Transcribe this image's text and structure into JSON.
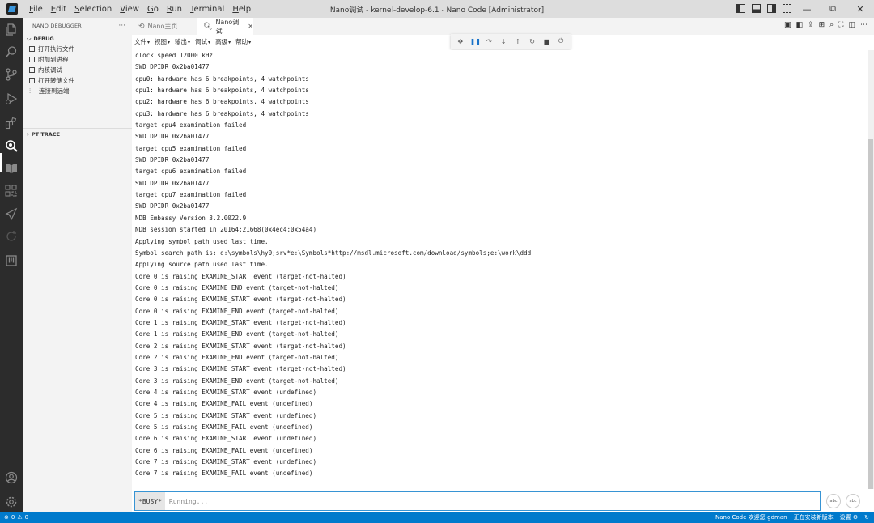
{
  "window": {
    "title": "Nano调试 - kernel-develop-6.1 - Nano Code [Administrator]",
    "menu": [
      "File",
      "Edit",
      "Selection",
      "View",
      "Go",
      "Run",
      "Terminal",
      "Help"
    ],
    "controls": {
      "minimize": "—",
      "restore": "⧉",
      "close": "✕"
    }
  },
  "activity_bar": {
    "icons": [
      "files-icon",
      "search-icon",
      "source-control-icon",
      "run-debug-icon",
      "extensions-icon",
      "nano-debug-icon",
      "book-icon",
      "apps-icon",
      "rocket-icon",
      "sync-icon",
      "board-icon"
    ],
    "bottom": [
      "account-icon",
      "settings-gear-icon"
    ],
    "active": "nano-debug-icon"
  },
  "sidebar": {
    "header": "NANO DEBUGGER",
    "more": "···",
    "debug_section": "DEBUG",
    "items": [
      "打开执行文件",
      "附加到进程",
      "内核调试",
      "打开转储文件",
      "连接到远端"
    ],
    "pt_trace_section": "PT TRACE"
  },
  "tabs": [
    {
      "label": "Nano主页",
      "icon": "nano-home-icon"
    },
    {
      "label": "Nano调试",
      "icon": "search-debug-icon",
      "close": "✕"
    }
  ],
  "editor_toolbar": [
    "文件",
    "视图",
    "输出",
    "调试",
    "高级",
    "帮助"
  ],
  "debug_toolbar": [
    "move-handle-icon",
    "pause-icon",
    "step-over-icon",
    "step-into-icon",
    "step-out-icon",
    "restart-icon",
    "stop-icon",
    "disconnect-icon"
  ],
  "console_lines": [
    "clock speed 12000 kHz",
    "SWD DPIDR 0x2ba01477",
    "cpu0: hardware has 6 breakpoints, 4 watchpoints",
    "cpu1: hardware has 6 breakpoints, 4 watchpoints",
    "cpu2: hardware has 6 breakpoints, 4 watchpoints",
    "cpu3: hardware has 6 breakpoints, 4 watchpoints",
    "target cpu4 examination failed",
    "SWD DPIDR 0x2ba01477",
    "target cpu5 examination failed",
    "SWD DPIDR 0x2ba01477",
    "target cpu6 examination failed",
    "SWD DPIDR 0x2ba01477",
    "target cpu7 examination failed",
    "SWD DPIDR 0x2ba01477",
    "NDB Embassy Version 3.2.0022.9",
    "NDB session started in 20164:21668(0x4ec4:0x54a4)",
    "Applying symbol path used last time.",
    "Symbol search path is: d:\\symbols\\hy0;srv*e:\\Symbols*http://msdl.microsoft.com/download/symbols;e:\\work\\ddd",
    "Applying source path used last time.",
    "Core 0 is raising EXAMINE_START event (target-not-halted)",
    "Core 0 is raising EXAMINE_END event (target-not-halted)",
    "Core 0 is raising EXAMINE_START event (target-not-halted)",
    "Core 0 is raising EXAMINE_END event (target-not-halted)",
    "Core 1 is raising EXAMINE_START event (target-not-halted)",
    "Core 1 is raising EXAMINE_END event (target-not-halted)",
    "Core 2 is raising EXAMINE_START event (target-not-halted)",
    "Core 2 is raising EXAMINE_END event (target-not-halted)",
    "Core 3 is raising EXAMINE_START event (target-not-halted)",
    "Core 3 is raising EXAMINE_END event (target-not-halted)",
    "Core 4 is raising EXAMINE_START event (undefined)",
    "Core 4 is raising EXAMINE_FAIL event (undefined)",
    "Core 5 is raising EXAMINE_START event (undefined)",
    "Core 5 is raising EXAMINE_FAIL event (undefined)",
    "Core 6 is raising EXAMINE_START event (undefined)",
    "Core 6 is raising EXAMINE_FAIL event (undefined)",
    "Core 7 is raising EXAMINE_START event (undefined)",
    "Core 7 is raising EXAMINE_FAIL event (undefined)"
  ],
  "command": {
    "busy_label": "*BUSY*",
    "placeholder": "Running...",
    "btn1": "abc",
    "btn2": "abc"
  },
  "statusbar": {
    "errors": "0",
    "warnings": "0",
    "user": "Nano Code 欢迎您-gdman",
    "install": "正在安装新版本",
    "settings": "设置",
    "colors": {
      "background": "#007acc"
    }
  }
}
